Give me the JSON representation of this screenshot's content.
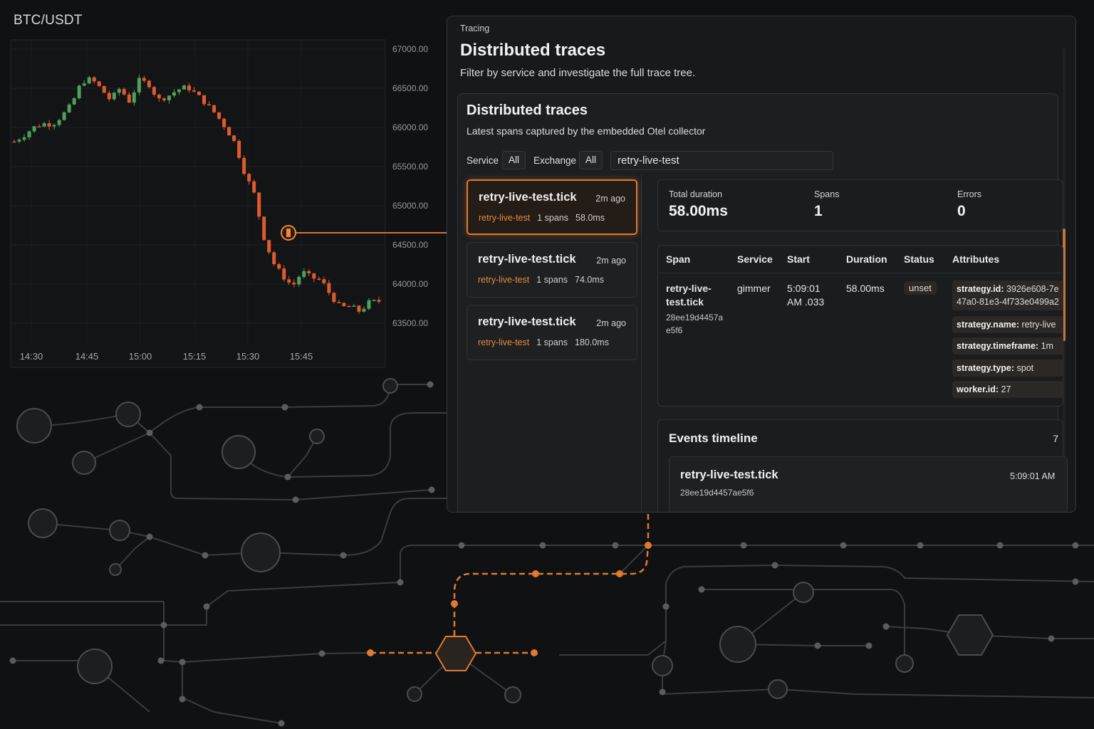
{
  "pair": "BTC/USDT",
  "chart_data": {
    "type": "candlestick",
    "title": "BTC/USDT",
    "y_ticks": [
      "67000.00",
      "66500.00",
      "66000.00",
      "65500.00",
      "65000.00",
      "64500.00",
      "64000.00",
      "63500.00"
    ],
    "x_ticks": [
      "14:30",
      "14:45",
      "15:00",
      "15:15",
      "15:30",
      "15:45"
    ],
    "ylim": [
      63500,
      67000
    ],
    "grid": true,
    "close_path": [
      65820,
      65900,
      66000,
      66050,
      66040,
      66150,
      66300,
      66580,
      66620,
      66500,
      66350,
      66500,
      66330,
      66600,
      66560,
      66350,
      66400,
      66480,
      66520,
      66420,
      66300,
      66170,
      66000,
      65800,
      65420,
      65150,
      64600,
      64270,
      64100,
      63970,
      64160,
      64080,
      64050,
      63850,
      63700,
      63720,
      63650,
      63770,
      63780
    ]
  },
  "panel": {
    "eyebrow": "Tracing",
    "title": "Distributed traces",
    "subtitle": "Filter by service and investigate the full trace tree."
  },
  "card": {
    "title": "Distributed traces",
    "subtitle": "Latest spans captured by the embedded Otel collector",
    "filters": {
      "service_label": "Service",
      "service_value": "All",
      "exchange_label": "Exchange",
      "exchange_value": "All",
      "search_value": "retry-live-test"
    }
  },
  "traces": [
    {
      "name": "retry-live-test.tick",
      "ago": "2m ago",
      "service": "retry-live-test",
      "spans": "1 spans",
      "duration": "58.0ms"
    },
    {
      "name": "retry-live-test.tick",
      "ago": "2m ago",
      "service": "retry-live-test",
      "spans": "1 spans",
      "duration": "74.0ms"
    },
    {
      "name": "retry-live-test.tick",
      "ago": "2m ago",
      "service": "retry-live-test",
      "spans": "1 spans",
      "duration": "180.0ms"
    }
  ],
  "stats": {
    "total_duration_label": "Total duration",
    "total_duration": "58.00ms",
    "spans_label": "Spans",
    "spans": "1",
    "errors_label": "Errors",
    "errors": "0"
  },
  "span_table": {
    "headers": {
      "span": "Span",
      "service": "Service",
      "start": "Start",
      "duration": "Duration",
      "status": "Status",
      "attributes": "Attributes"
    },
    "row": {
      "span_line1": "retry-live-",
      "span_line2": "test.tick",
      "span_id1": "28ee19d4457a",
      "span_id2": "e5f6",
      "service": "gimmer",
      "start_line1": "5:09:01",
      "start_line2": "AM .033",
      "duration": "58.00ms",
      "status": "unset"
    },
    "attributes": [
      {
        "key": "strategy.id:",
        "value": "3926e608-7e",
        "value2": "47a0-81e3-4f733e0499a2"
      },
      {
        "key": "strategy.name:",
        "value": "retry-live"
      },
      {
        "key": "strategy.timeframe:",
        "value": "1m"
      },
      {
        "key": "strategy.type:",
        "value": "spot"
      },
      {
        "key": "worker.id:",
        "value": "27"
      }
    ]
  },
  "events": {
    "title": "Events timeline",
    "count": "7",
    "items": [
      {
        "name": "retry-live-test.tick",
        "time": "5:09:01 AM",
        "id": "28ee19d4457ae5f6"
      }
    ]
  },
  "colors": {
    "accent": "#e07a2e",
    "bull": "#4fa05a",
    "bear": "#e05a2e",
    "background": "#0f1113"
  }
}
